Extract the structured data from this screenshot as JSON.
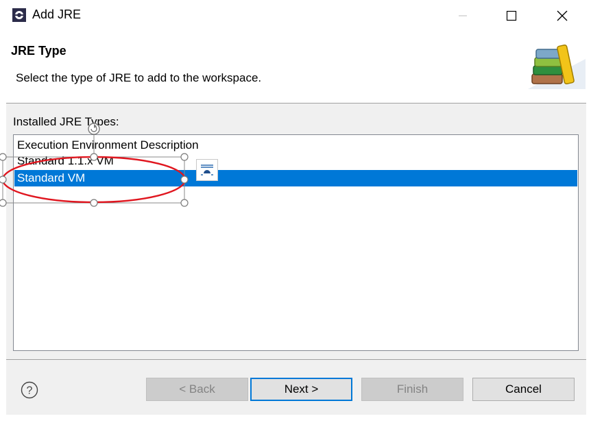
{
  "window": {
    "title": "Add JRE",
    "icon": "eclipse-app-icon",
    "controls": [
      "minimize-icon",
      "maximize-icon",
      "close-icon"
    ]
  },
  "header": {
    "title": "JRE Type",
    "description": "Select the type of JRE to add to the workspace.",
    "image": "library-books-icon"
  },
  "list": {
    "label": "Installed JRE Types:",
    "items": [
      {
        "label": "Execution Environment Description",
        "selected": false
      },
      {
        "label": "Standard 1.1.x VM",
        "selected": false
      },
      {
        "label": "Standard VM",
        "selected": true
      }
    ]
  },
  "buttons": {
    "back": "< Back",
    "next": "Next >",
    "finish": "Finish",
    "cancel": "Cancel",
    "help_icon": "help-icon"
  },
  "annotation": {
    "shape": "ellipse",
    "color": "#e0161f",
    "description_icon": "layout-options-icon"
  },
  "colors": {
    "selection": "#0078d7",
    "dialog_bg": "#f0f0f0",
    "default_button_border": "#0078d7"
  }
}
